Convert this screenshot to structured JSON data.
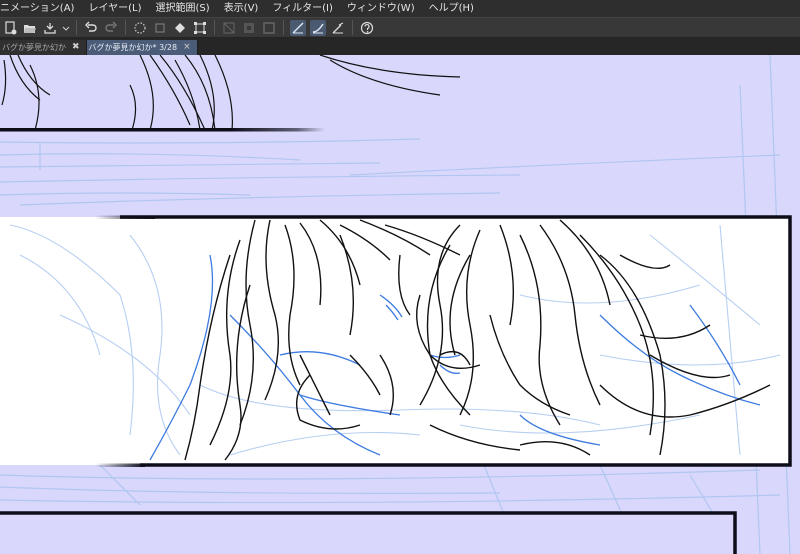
{
  "menu": [
    "ニメーション(A)",
    "レイヤー(L)",
    "選択範囲(S)",
    "表示(V)",
    "フィルター(I)",
    "ウィンドウ(W)",
    "ヘルプ(H)"
  ],
  "toolbar_icons": [
    "new-canvas-icon",
    "open-file-icon",
    "save-icon",
    "dropdown-icon",
    "undo-icon",
    "redo-icon",
    "loading-spinner-icon",
    "clear-icon",
    "fill-icon",
    "transform-icon",
    "deselect-icon",
    "invert-selection-icon",
    "selection-border-icon",
    "snap-ruler-icon",
    "snap-special-ruler-icon",
    "snap-grid-icon",
    "help-icon"
  ],
  "tabs": [
    {
      "label": "バグか夢見か幻か",
      "active": false
    },
    {
      "label": "バグか夢見か幻か* 3/28",
      "active": true
    }
  ],
  "colors": {
    "canvas_bg": "#d9d8fc",
    "panel_white": "#ffffff",
    "frame_border": "#0d0d1a",
    "blue_sketch": "#3d7be0",
    "light_sketch": "#a9c4ee"
  }
}
